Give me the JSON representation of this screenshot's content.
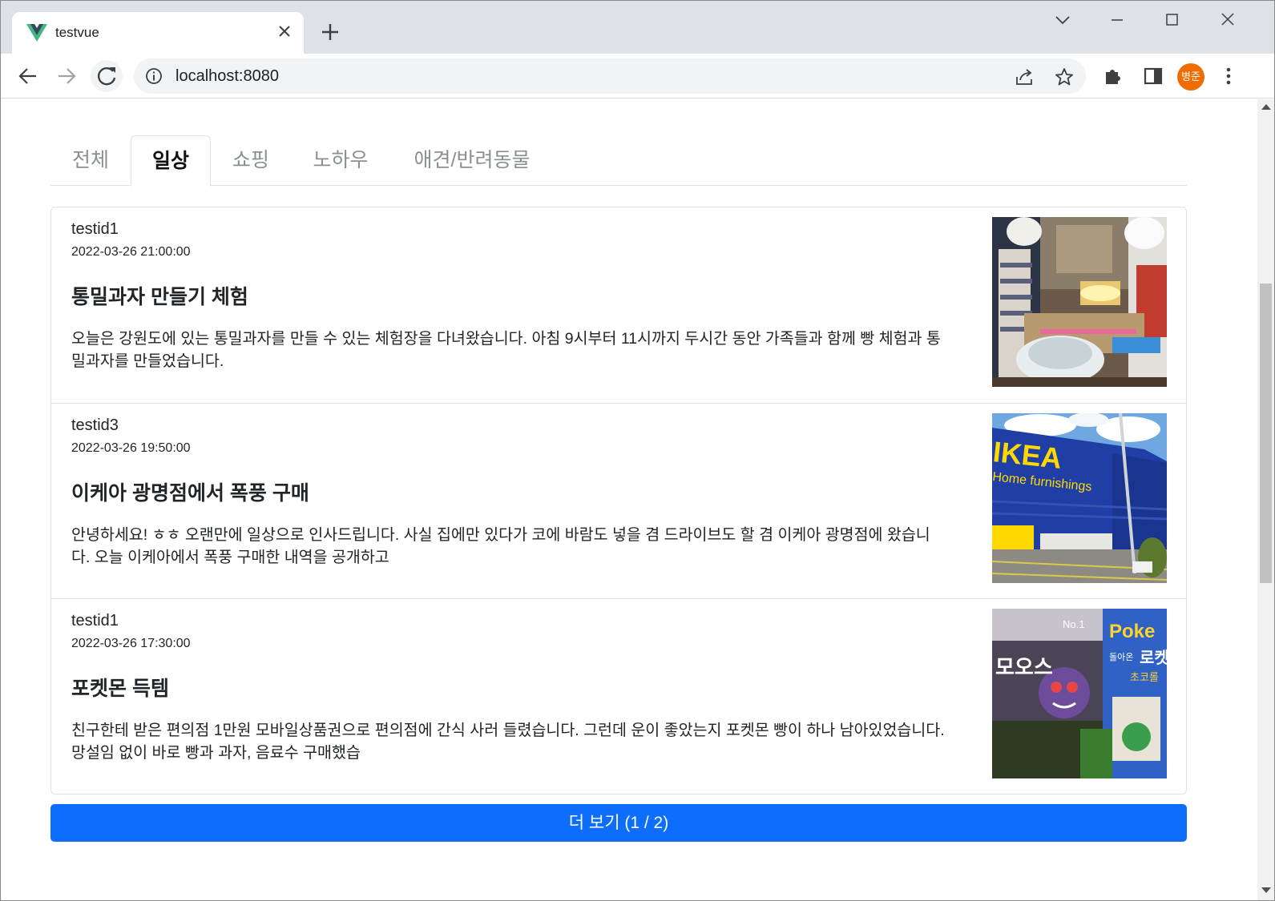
{
  "browser": {
    "tab_title": "testvue",
    "url": "localhost:8080",
    "profile_initials": "병준"
  },
  "categories": [
    "전체",
    "일상",
    "쇼핑",
    "노하우",
    "애견/반려동물"
  ],
  "active_category": "일상",
  "posts": [
    {
      "author": "testid1",
      "date": "2022-03-26 21:00:00",
      "title": "통밀과자 만들기 체험",
      "body": "오늘은 강원도에 있는 통밀과자를 만들 수 있는 체험장을 다녀왔습니다. 아침 9시부터 11시까지 두시간 동안 가족들과 함께 빵 체험과 통밀과자를 만들었습니다.",
      "thumbnail": "photo-cooking-class"
    },
    {
      "author": "testid3",
      "date": "2022-03-26 19:50:00",
      "title": "이케아 광명점에서 폭풍 구매",
      "body": "안녕하세요! ㅎㅎ 오랜만에 일상으로 인사드립니다. 사실 집에만 있다가 코에 바람도 넣을 겸 드라이브도 할 겸 이케아 광명점에 왔습니다. 오늘 이케아에서 폭풍 구매한 내역을 공개하고",
      "thumbnail": "photo-ikea-store",
      "thumb_sign_line1": "IKEA",
      "thumb_sign_line2": "Home furnishings"
    },
    {
      "author": "testid1",
      "date": "2022-03-26 17:30:00",
      "title": "포켓몬 득템",
      "body": "친구한테 받은 편의점 1만원 모바일상품권으로 편의점에 간식 사러 들렸습니다. 그런데 운이 좋았는지 포켓몬 빵이 하나 남아있었습니다. 망설임 없이 바로 빵과 과자, 음료수 구매했습",
      "thumbnail": "photo-pokemon-bread",
      "thumb_text_1": "모오스",
      "thumb_text_2": "Poke",
      "thumb_text_3": "로켓",
      "thumb_text_4": "No.1",
      "thumb_text_5": "돌아온",
      "thumb_text_6": "초코롤"
    }
  ],
  "more_button_label": "더 보기 (1 / 2)",
  "colors": {
    "primary": "#0d6efd",
    "avatar": "#ef6c00",
    "vue_green": "#41b883",
    "vue_dark": "#35495e"
  }
}
